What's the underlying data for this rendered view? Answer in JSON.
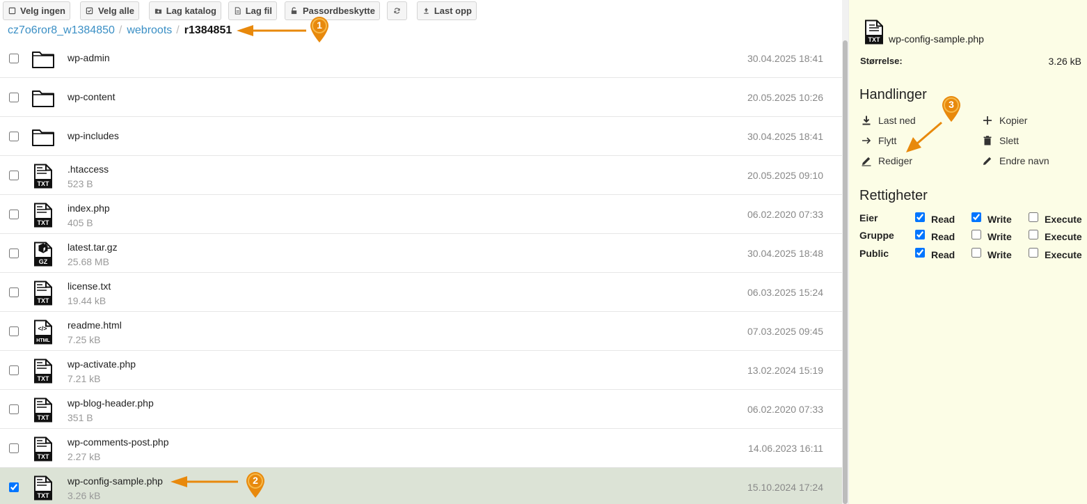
{
  "toolbar": {
    "select_none": "Velg ingen",
    "select_all": "Velg alle",
    "make_dir": "Lag katalog",
    "make_file": "Lag fil",
    "password_protect": "Passordbeskytte",
    "upload": "Last opp"
  },
  "breadcrumb": {
    "items": [
      "cz7o6ror8_w1384850",
      "webroots"
    ],
    "separator": "/",
    "current": "r1384851"
  },
  "files": [
    {
      "name": "wp-admin",
      "size": "",
      "date": "30.04.2025 18:41",
      "type": "folder",
      "checked": false
    },
    {
      "name": "wp-content",
      "size": "",
      "date": "20.05.2025 10:26",
      "type": "folder",
      "checked": false
    },
    {
      "name": "wp-includes",
      "size": "",
      "date": "30.04.2025 18:41",
      "type": "folder",
      "checked": false
    },
    {
      "name": ".htaccess",
      "size": "523 B",
      "date": "20.05.2025 09:10",
      "type": "txt",
      "checked": false
    },
    {
      "name": "index.php",
      "size": "405 B",
      "date": "06.02.2020 07:33",
      "type": "txt",
      "checked": false
    },
    {
      "name": "latest.tar.gz",
      "size": "25.68 MB",
      "date": "30.04.2025 18:48",
      "type": "gz",
      "checked": false
    },
    {
      "name": "license.txt",
      "size": "19.44 kB",
      "date": "06.03.2025 15:24",
      "type": "txt",
      "checked": false
    },
    {
      "name": "readme.html",
      "size": "7.25 kB",
      "date": "07.03.2025 09:45",
      "type": "html",
      "checked": false
    },
    {
      "name": "wp-activate.php",
      "size": "7.21 kB",
      "date": "13.02.2024 15:19",
      "type": "txt",
      "checked": false
    },
    {
      "name": "wp-blog-header.php",
      "size": "351 B",
      "date": "06.02.2020 07:33",
      "type": "txt",
      "checked": false
    },
    {
      "name": "wp-comments-post.php",
      "size": "2.27 kB",
      "date": "14.06.2023 16:11",
      "type": "txt",
      "checked": false
    },
    {
      "name": "wp-config-sample.php",
      "size": "3.26 kB",
      "date": "15.10.2024 17:24",
      "type": "txt",
      "checked": true
    }
  ],
  "file_icon_labels": {
    "txt": "TXT",
    "gz": "GZ",
    "html": "HTML",
    "html_glyph": "</>"
  },
  "details": {
    "file_name": "wp-config-sample.php",
    "file_icon": "TXT",
    "size_label": "Størrelse:",
    "size_value": "3.26 kB"
  },
  "actions": {
    "title": "Handlinger",
    "download": "Last ned",
    "copy": "Kopier",
    "move": "Flytt",
    "delete": "Slett",
    "edit": "Rediger",
    "rename": "Endre navn"
  },
  "permissions": {
    "title": "Rettigheter",
    "columns": [
      "Read",
      "Write",
      "Execute"
    ],
    "rows": [
      {
        "label": "Eier",
        "values": [
          true,
          true,
          false
        ]
      },
      {
        "label": "Gruppe",
        "values": [
          true,
          false,
          false
        ]
      },
      {
        "label": "Public",
        "values": [
          true,
          false,
          false
        ]
      }
    ]
  },
  "annotations": {
    "marker_1": "1",
    "marker_2": "2",
    "marker_3": "3",
    "color": "#e8890c"
  },
  "colors": {
    "link": "#3a8fc5",
    "selected_row": "#dce3d6",
    "details_bg": "#fcfde6"
  }
}
